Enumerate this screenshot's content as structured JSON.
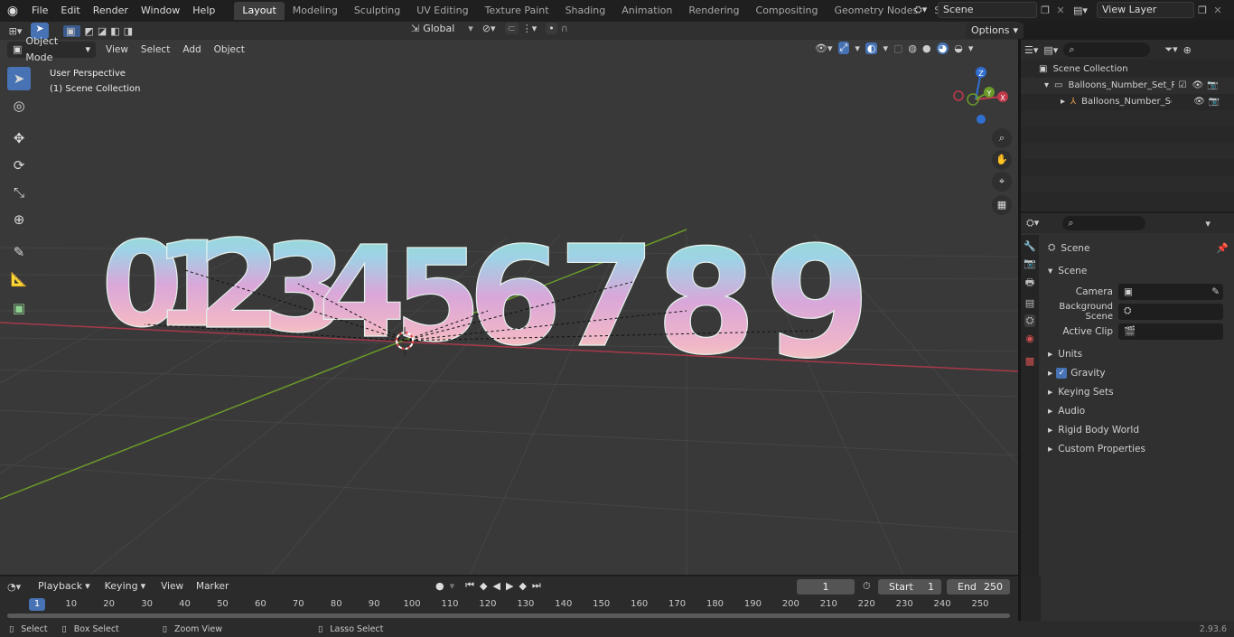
{
  "topbar": {
    "menus": [
      "File",
      "Edit",
      "Render",
      "Window",
      "Help"
    ],
    "workspaces": [
      "Layout",
      "Modeling",
      "Sculpting",
      "UV Editing",
      "Texture Paint",
      "Shading",
      "Animation",
      "Rendering",
      "Compositing",
      "Geometry Nodes",
      "Scripting"
    ],
    "active_workspace": "Layout",
    "scene_name": "Scene",
    "view_layer": "View Layer"
  },
  "header": {
    "mode": "Object Mode",
    "menus": [
      "View",
      "Select",
      "Add",
      "Object"
    ],
    "transform_orientation": "Global",
    "options_label": "Options"
  },
  "viewport": {
    "perspective_label": "User Perspective",
    "collection_label": "(1) Scene Collection",
    "balloon_digits": [
      "0",
      "1",
      "2",
      "3",
      "4",
      "5",
      "6",
      "7",
      "8",
      "9"
    ],
    "gizmo_axes": [
      "Z",
      "Y",
      "X"
    ]
  },
  "outliner": {
    "root": "Scene Collection",
    "items": [
      "Balloons_Number_Set_Rainbo",
      "Balloons_Number_Set_Ra"
    ]
  },
  "properties": {
    "context": "Scene",
    "section": "Scene",
    "fields": [
      {
        "label": "Camera",
        "value": ""
      },
      {
        "label": "Background Scene",
        "value": ""
      },
      {
        "label": "Active Clip",
        "value": ""
      }
    ],
    "panels": [
      "Units",
      "Gravity",
      "Keying Sets",
      "Audio",
      "Rigid Body World",
      "Custom Properties"
    ],
    "gravity_checked": true
  },
  "timeline": {
    "menus": [
      "Playback",
      "Keying",
      "View",
      "Marker"
    ],
    "current_frame": "1",
    "start_label": "Start",
    "start": "1",
    "end_label": "End",
    "end": "250",
    "ticks": [
      "1",
      "10",
      "20",
      "30",
      "40",
      "50",
      "60",
      "70",
      "80",
      "90",
      "100",
      "110",
      "120",
      "130",
      "140",
      "150",
      "160",
      "170",
      "180",
      "190",
      "200",
      "210",
      "220",
      "230",
      "240",
      "250"
    ]
  },
  "statusbar": {
    "select": "Select",
    "box_select": "Box Select",
    "zoom_view": "Zoom View",
    "lasso_select": "Lasso Select",
    "version": "2.93.6"
  },
  "colors": {
    "accent": "#4772b3",
    "x_axis": "#c0394b",
    "y_axis": "#6a9a2a",
    "z_axis": "#2f6fd0"
  }
}
